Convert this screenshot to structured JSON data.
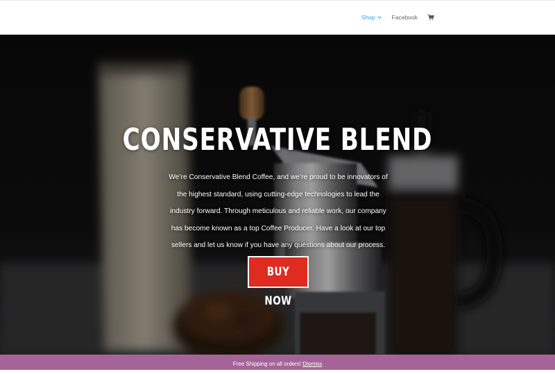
{
  "nav": {
    "items": [
      {
        "label": "Shop",
        "active": true,
        "has_dropdown": true
      },
      {
        "label": "Facebook",
        "active": false,
        "has_dropdown": false
      }
    ],
    "cart_icon": "shopping-cart-icon",
    "active_color": "#2ea3f2"
  },
  "hero": {
    "title": "CONSERVATIVE BLEND",
    "description": "We’re Conservative Blend Coffee, and we’re proud to be innovators of the highest standard, using cutting-edge technologies to lead the industry forward. Through meticulous and reliable work, our company has become known as a top Coffee Producer. Have a look at our top sellers and let us know if you have any questions about our process.",
    "button_label": "BUY NOW",
    "button_color": "#e02b20"
  },
  "notice": {
    "text": "Free Shipping on all orders!",
    "dismiss_label": "Dismiss",
    "background": "#a46497"
  }
}
